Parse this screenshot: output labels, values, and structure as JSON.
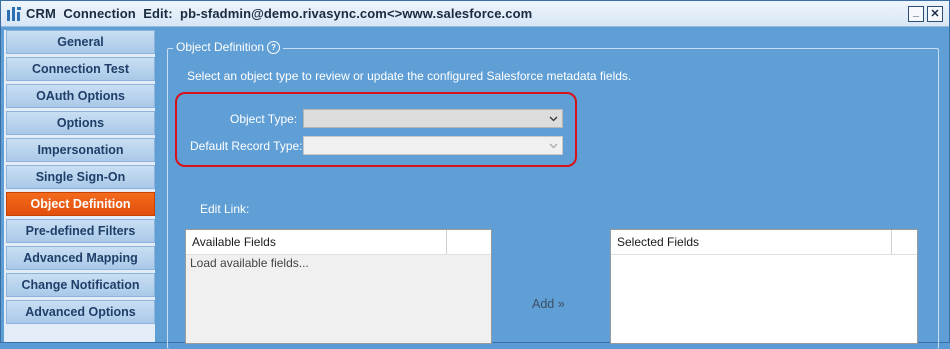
{
  "window": {
    "title": "CRM  Connection  Edit:  pb-sfadmin@demo.rivasync.com<>www.salesforce.com",
    "minimize_glyph": "_",
    "close_glyph": "✕"
  },
  "sidebar": {
    "items": [
      {
        "label": "General"
      },
      {
        "label": "Connection Test"
      },
      {
        "label": "OAuth Options"
      },
      {
        "label": "Options"
      },
      {
        "label": "Impersonation"
      },
      {
        "label": "Single Sign-On"
      },
      {
        "label": "Object Definition",
        "active": true
      },
      {
        "label": "Pre-defined Filters"
      },
      {
        "label": "Advanced Mapping"
      },
      {
        "label": "Change Notification"
      },
      {
        "label": "Advanced Options"
      }
    ]
  },
  "main": {
    "group_title": "Object Definition",
    "help_glyph": "?",
    "description": "Select an object type to review or update the configured Salesforce metadata fields.",
    "object_type_label": "Object Type:",
    "object_type_value": "",
    "default_record_type_label": "Default Record Type:",
    "default_record_type_value": "",
    "edit_link_label": "Edit Link:",
    "available_fields": {
      "header": "Available Fields",
      "rows": [
        "Load available fields..."
      ]
    },
    "add_button": "Add »",
    "selected_fields": {
      "header": "Selected Fields"
    }
  },
  "colors": {
    "accent_active": "#e95a12",
    "highlight_border": "#d8121b",
    "panel_bg": "#5f9fd5"
  }
}
